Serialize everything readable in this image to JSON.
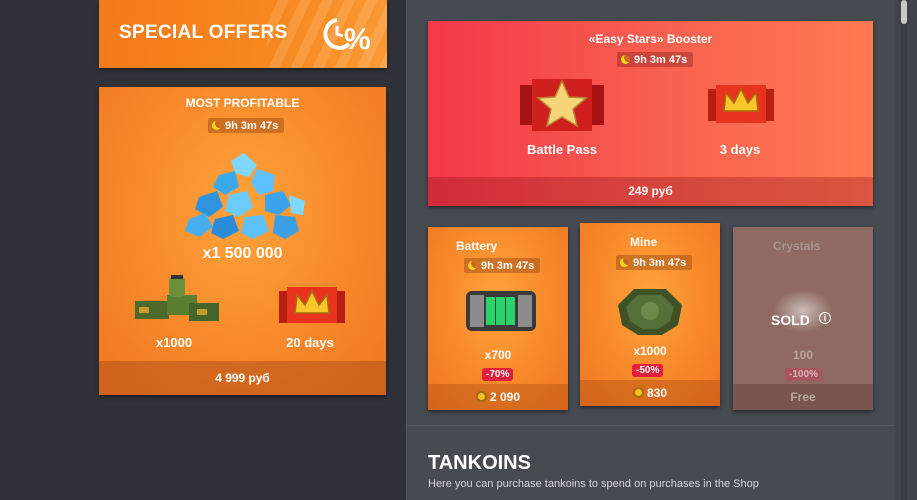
{
  "special_offers": {
    "title": "SPECIAL OFFERS"
  },
  "most_profitable": {
    "header": "MOST PROFITABLE",
    "timer": "9h 3m 47s",
    "crystals_amount": "x1 500 000",
    "supplies_amount": "x1000",
    "premium_days": "20 days",
    "price": "4 999 руб"
  },
  "booster": {
    "title": "«Easy Stars» Booster",
    "timer": "9h 3m 47s",
    "item1_label": "Battle Pass",
    "item2_label": "3 days",
    "price": "249 руб"
  },
  "battery": {
    "title": "Battery",
    "timer": "9h 3m 47s",
    "amount": "x700",
    "discount": "-70%",
    "price": "2 090"
  },
  "mine": {
    "title": "Mine",
    "timer": "9h 3m 47s",
    "amount": "x1000",
    "discount": "-50%",
    "price": "830"
  },
  "crystals": {
    "title": "Crystals",
    "sold_label": "SOLD",
    "amount": "100",
    "discount": "-100%",
    "price": "Free"
  },
  "tankoins": {
    "title": "TANKOINS",
    "subtitle": "Here you can purchase tankoins to spend on purchases in the Shop"
  },
  "colors": {
    "accent_orange": "#f7881f",
    "booster_red": "#f5424c",
    "discount_red": "#e11e3b"
  }
}
